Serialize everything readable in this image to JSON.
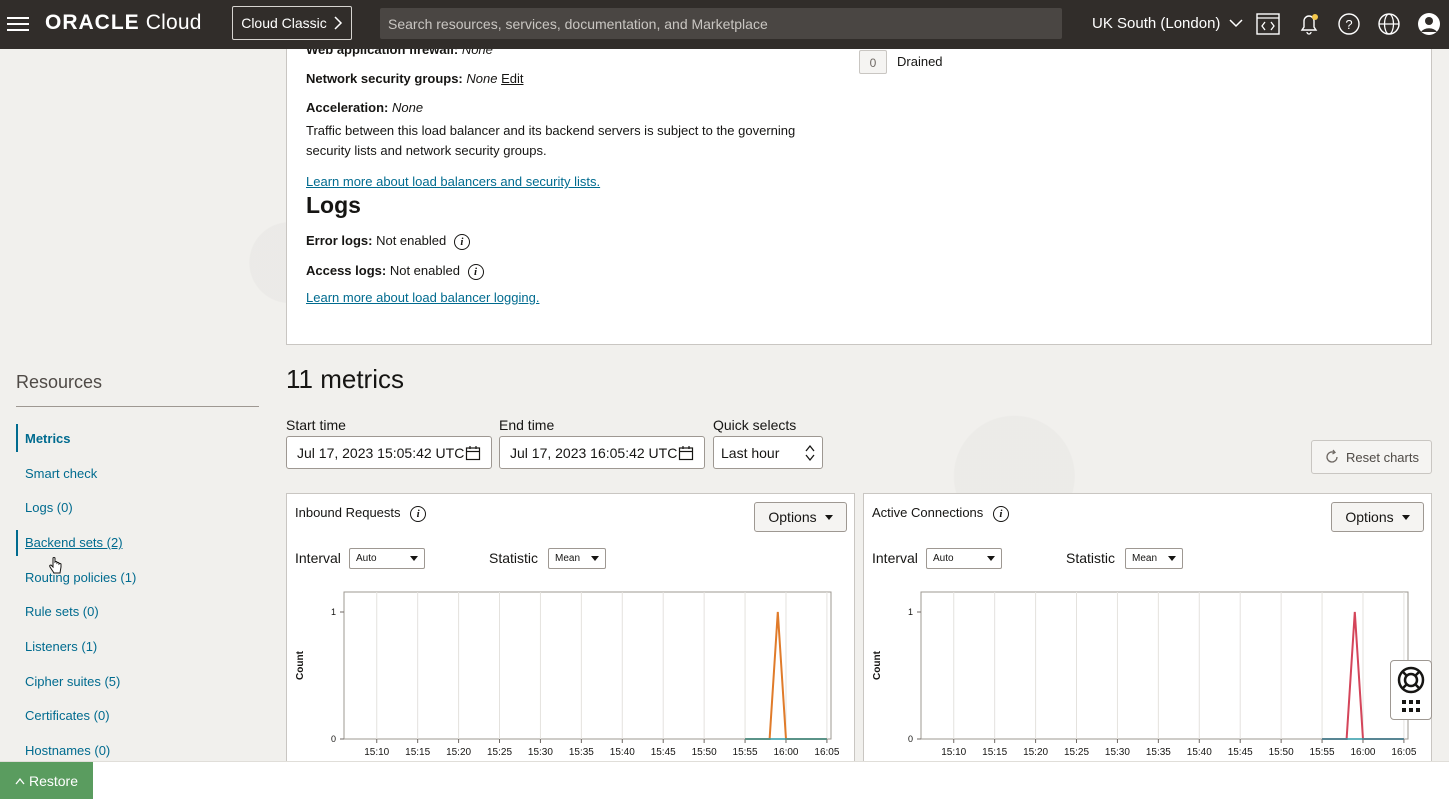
{
  "topbar": {
    "logo_brand": "ORACLE",
    "logo_product": "Cloud",
    "cloud_classic_label": "Cloud Classic",
    "search_placeholder": "Search resources, services, documentation, and Marketplace",
    "region_label": "UK South (London)"
  },
  "details": {
    "waf_label": "Web application firewall:",
    "waf_value": "None",
    "nsg_label": "Network security groups:",
    "nsg_value": "None",
    "nsg_edit": "Edit",
    "acceleration_label": "Acceleration:",
    "acceleration_value": "None",
    "traffic_note": "Traffic between this load balancer and its backend servers is subject to the governing security lists and network security groups.",
    "security_link": "Learn more about load balancers and security lists.",
    "drained_count": "0",
    "drained_label": "Drained"
  },
  "logs": {
    "heading": "Logs",
    "error_label": "Error logs:",
    "error_value": "Not enabled",
    "access_label": "Access logs:",
    "access_value": "Not enabled",
    "logging_link": "Learn more about load balancer logging."
  },
  "resources": {
    "title": "Resources",
    "items": [
      {
        "label": "Metrics"
      },
      {
        "label": "Smart check"
      },
      {
        "label": "Logs (0)"
      },
      {
        "label": "Backend sets (2)"
      },
      {
        "label": "Routing policies (1)"
      },
      {
        "label": "Rule sets (0)"
      },
      {
        "label": "Listeners (1)"
      },
      {
        "label": "Cipher suites (5)"
      },
      {
        "label": "Certificates (0)"
      },
      {
        "label": "Hostnames (0)"
      }
    ]
  },
  "metrics": {
    "heading": "11 metrics",
    "start_label": "Start time",
    "start_value": "Jul 17, 2023 15:05:42 UTC",
    "end_label": "End time",
    "end_value": "Jul 17, 2023 16:05:42 UTC",
    "quick_label": "Quick selects",
    "quick_value": "Last hour",
    "reset_label": "Reset charts",
    "interval_label": "Interval",
    "statistic_label": "Statistic",
    "interval_value": "Auto",
    "statistic_value": "Mean",
    "options_label": "Options",
    "count_label": "Count"
  },
  "chart_data": [
    {
      "type": "line",
      "title": "Inbound Requests",
      "xlabel": "",
      "ylabel": "Count",
      "x": [
        "15:10",
        "15:15",
        "15:20",
        "15:25",
        "15:30",
        "15:35",
        "15:40",
        "15:45",
        "15:50",
        "15:55",
        "16:00",
        "16:05"
      ],
      "ylim": [
        0,
        1
      ],
      "yticks": [
        "0",
        "1"
      ],
      "series": [
        {
          "color": "#e07b2a",
          "points": [
            [
              "15:55",
              0
            ],
            [
              "15:58",
              0
            ],
            [
              "15:59",
              1
            ],
            [
              "16:00",
              0
            ],
            [
              "16:05",
              0
            ]
          ]
        },
        {
          "color": "#2e9ba8",
          "points": [
            [
              "15:55",
              0
            ],
            [
              "16:05",
              0
            ]
          ]
        }
      ],
      "grid": true
    },
    {
      "type": "line",
      "title": "Active Connections",
      "xlabel": "",
      "ylabel": "Count",
      "x": [
        "15:10",
        "15:15",
        "15:20",
        "15:25",
        "15:30",
        "15:35",
        "15:40",
        "15:45",
        "15:50",
        "15:55",
        "16:00",
        "16:05"
      ],
      "ylim": [
        0,
        1
      ],
      "yticks": [
        "0",
        "1"
      ],
      "series": [
        {
          "color": "#d4455a",
          "points": [
            [
              "15:55",
              0
            ],
            [
              "15:58",
              0
            ],
            [
              "15:59",
              1
            ],
            [
              "16:00",
              0
            ],
            [
              "16:05",
              0
            ]
          ]
        },
        {
          "color": "#2e9ba8",
          "points": [
            [
              "15:55",
              0
            ],
            [
              "16:05",
              0
            ]
          ]
        }
      ],
      "grid": true
    }
  ],
  "footer": {
    "restore_label": "Restore"
  }
}
